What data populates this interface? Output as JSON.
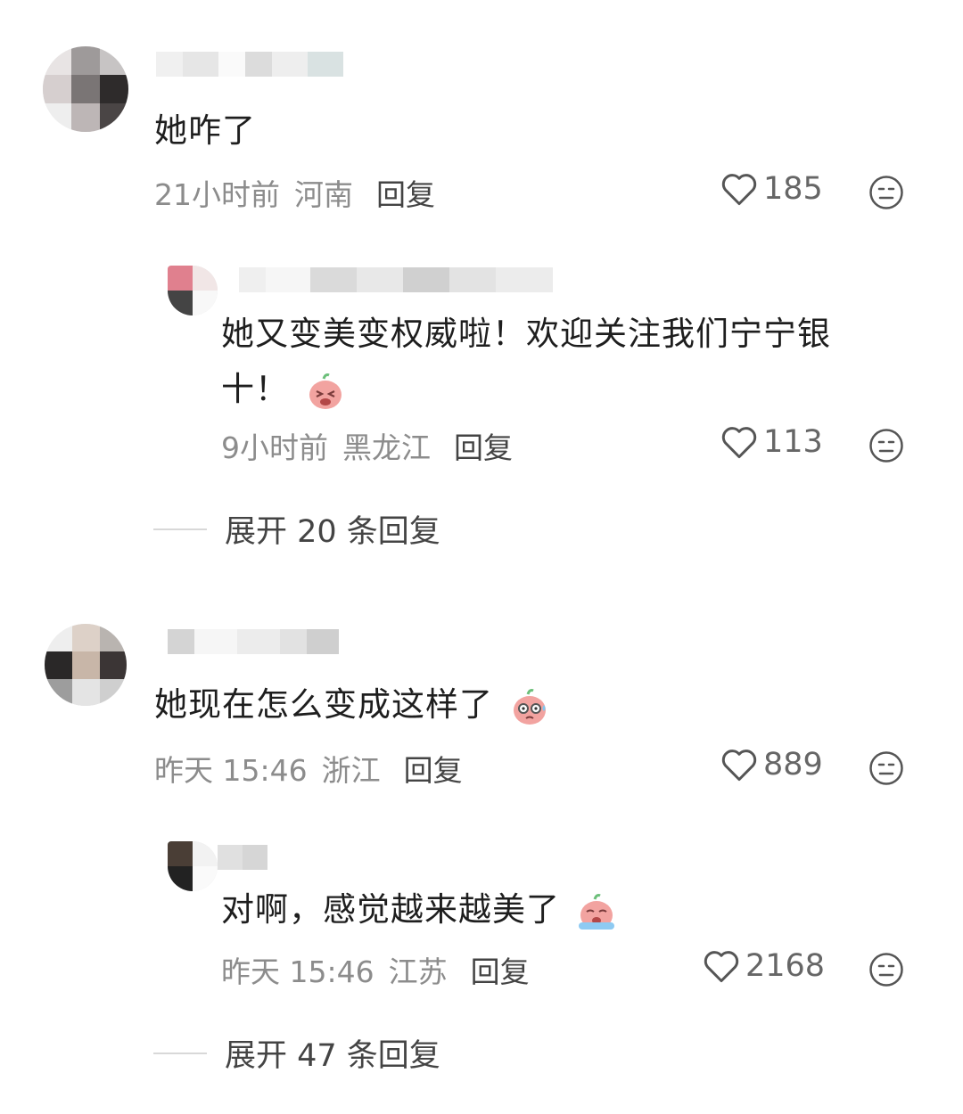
{
  "comments": [
    {
      "text": "她咋了",
      "time": "21小时前",
      "location": "河南",
      "reply_label": "回复",
      "likes": "185",
      "replies": [
        {
          "text_line1": "她又变美变权威啦！欢迎关注我们宁宁银",
          "text_line2": "十！",
          "time": "9小时前",
          "location": "黑龙江",
          "reply_label": "回复",
          "likes": "113"
        }
      ],
      "expand_label": "展开 20 条回复"
    },
    {
      "text": "她现在怎么变成这样了",
      "time": "昨天 15:46",
      "location": "浙江",
      "reply_label": "回复",
      "likes": "889",
      "replies": [
        {
          "text": "对啊，感觉越来越美了",
          "time": "昨天 15:46",
          "location": "江苏",
          "reply_label": "回复",
          "likes": "2168"
        }
      ],
      "expand_label": "展开 47 条回复"
    }
  ],
  "icons": {
    "like": "heart-outline-icon",
    "dislike": "meh-face-icon"
  }
}
